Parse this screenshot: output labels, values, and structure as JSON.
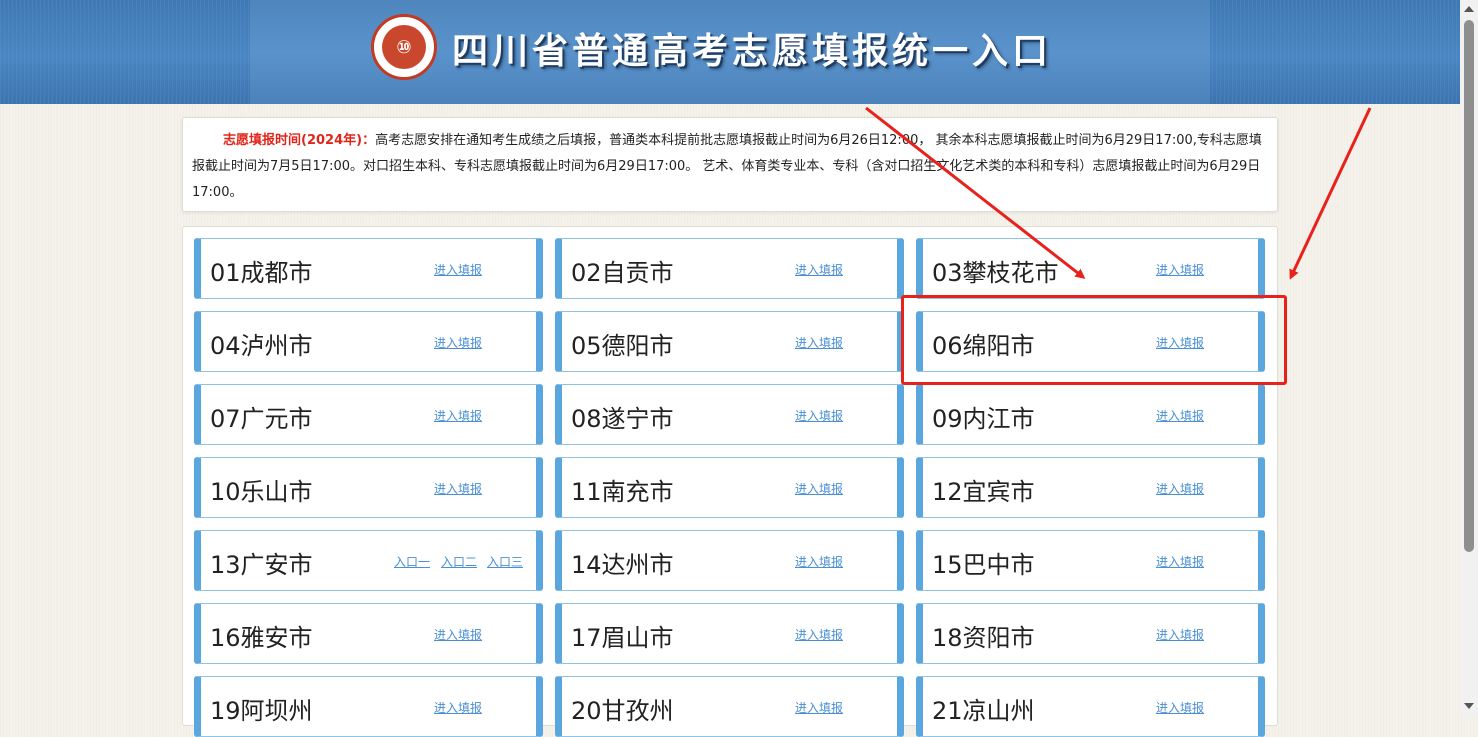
{
  "header": {
    "title": "四川省普通高考志愿填报统一入口",
    "logo_glyph": "⑩",
    "logo_icon": "university-seal-icon"
  },
  "notice": {
    "lead": "志愿填报时间(2024年)：",
    "body": "高考志愿安排在通知考生成绩之后填报，普通类本科提前批志愿填报截止时间为6月26日12:00， 其余本科志愿填报截止时间为6月29日17:00,专科志愿填报截止时间为7月5日17:00。对口招生本科、专科志愿填报截止时间为6月29日17:00。 艺术、体育类专业本、专科（含对口招生文化艺术类的本科和专科）志愿填报截止时间为6月29日17:00。"
  },
  "cities": [
    {
      "name": "01成都市",
      "links": [
        "进入填报"
      ]
    },
    {
      "name": "02自贡市",
      "links": [
        "进入填报"
      ]
    },
    {
      "name": "03攀枝花市",
      "links": [
        "进入填报"
      ]
    },
    {
      "name": "04泸州市",
      "links": [
        "进入填报"
      ]
    },
    {
      "name": "05德阳市",
      "links": [
        "进入填报"
      ]
    },
    {
      "name": "06绵阳市",
      "links": [
        "进入填报"
      ]
    },
    {
      "name": "07广元市",
      "links": [
        "进入填报"
      ]
    },
    {
      "name": "08遂宁市",
      "links": [
        "进入填报"
      ]
    },
    {
      "name": "09内江市",
      "links": [
        "进入填报"
      ]
    },
    {
      "name": "10乐山市",
      "links": [
        "进入填报"
      ]
    },
    {
      "name": "11南充市",
      "links": [
        "进入填报"
      ]
    },
    {
      "name": "12宜宾市",
      "links": [
        "进入填报"
      ]
    },
    {
      "name": "13广安市",
      "links": [
        "入口一",
        "入口二",
        "入口三"
      ]
    },
    {
      "name": "14达州市",
      "links": [
        "进入填报"
      ]
    },
    {
      "name": "15巴中市",
      "links": [
        "进入填报"
      ]
    },
    {
      "name": "16雅安市",
      "links": [
        "进入填报"
      ]
    },
    {
      "name": "17眉山市",
      "links": [
        "进入填报"
      ]
    },
    {
      "name": "18资阳市",
      "links": [
        "进入填报"
      ]
    },
    {
      "name": "19阿坝州",
      "links": [
        "进入填报"
      ]
    },
    {
      "name": "20甘孜州",
      "links": [
        "进入填报"
      ]
    },
    {
      "name": "21凉山州",
      "links": [
        "进入填报"
      ]
    }
  ],
  "annotation": {
    "highlighted": "06绵阳市",
    "color": "#e8211a"
  },
  "colors": {
    "header_blue": "#4a86c3",
    "card_accent": "#5aa6df",
    "link": "#4a8fd4",
    "notice_lead": "#e0261b"
  }
}
